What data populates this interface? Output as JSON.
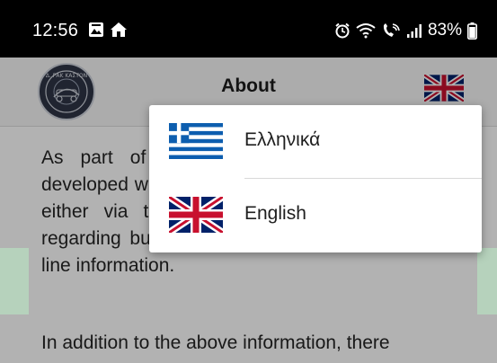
{
  "status_bar": {
    "time": "12:56",
    "battery": "83%",
    "left_icons": [
      "image-notification-icon",
      "home-notification-icon"
    ],
    "right_icons": [
      "alarm-icon",
      "wifi-icon",
      "wifi-calling-icon",
      "signal-icon",
      "battery-icon"
    ]
  },
  "app_bar": {
    "title": "About",
    "logo_icon": "organization-logo",
    "language_button_icon": "uk-flag-icon",
    "logo_text": "Δ. ΡΑΚ ΚΑΣΤΟΝ"
  },
  "content": {
    "paragraph_1": "As part of this project, the application was developed which allows information to be received, either via the internet or via mobile phones, regarding bus arrival times from stops as well as line information.",
    "paragraph_2": "In addition to the above information, there"
  },
  "language_menu": {
    "items": [
      {
        "label": "Ελληνικά",
        "icon": "greek-flag-icon"
      },
      {
        "label": "English",
        "icon": "uk-flag-icon"
      }
    ]
  },
  "colors": {
    "status_bar": "#000000",
    "app_bar": "#f6f6f6",
    "menu_background": "#ffffff",
    "greek_flag_blue": "#0d5eaf",
    "uk_flag_blue": "#012169",
    "uk_flag_red": "#c8102e"
  }
}
